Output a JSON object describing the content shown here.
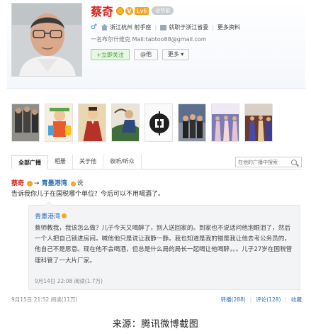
{
  "profile": {
    "name": "蔡奇",
    "level_badge": "Lv6",
    "tag_pill": "@华前",
    "meta": {
      "location": "浙江杭州 射手座",
      "job": "就职于浙江省委",
      "more": "更多资料"
    },
    "bio": "一名布尔什维克  Mail:tabtoo88@gmail.com",
    "follow_label": "+立即关注",
    "at_label": "@他",
    "more_label": "更多"
  },
  "tabs": [
    "全部广播",
    "相册",
    "关于他",
    "收听/听众"
  ],
  "search": {
    "placeholder": "在他的广播中搜索"
  },
  "post": {
    "author": "蔡奇",
    "target": "青墨港湾",
    "say": "说",
    "text": "告诉我你儿子在国税哪个单位？今后可以不用喝酒了。",
    "quote": {
      "author": "青墨港湾",
      "text": "蔡师教我，我该怎么做？儿子今天又喝醉了，别人送回家的。到家也不说话问他泡眼泪了，然后一个人把自己锁进房间。喊他他只是说让我静一静。我也知道是我的错是我让他去考公务员的，他自己不是愿意。现在他不会喝酒，但总是什么局的局长一起喝让他喝醉，。。儿子27岁在国税管理科管了一大片厂家。",
      "meta": "9月14日 22:08  阅读(1.7万)"
    },
    "meta": "9月15日 21:52  阅读(11万)",
    "actions": [
      "转播(288)",
      "评论(128)",
      "收藏"
    ]
  },
  "caption": "来源：腾讯微博截图"
}
